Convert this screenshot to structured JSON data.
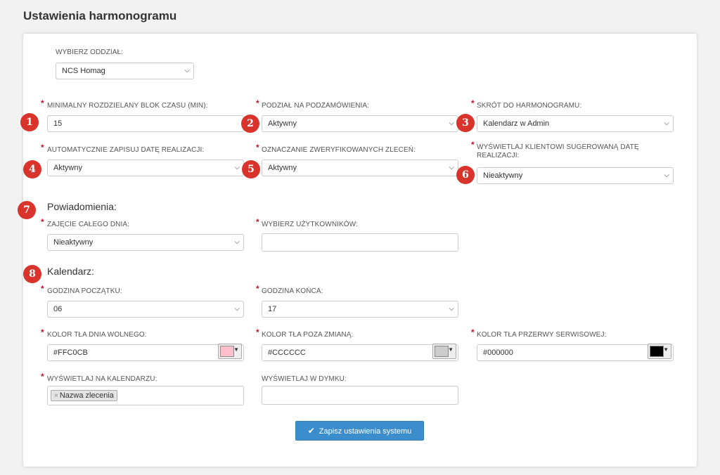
{
  "page": {
    "title": "Ustawienia harmonogramu"
  },
  "branch": {
    "label": "WYBIERZ ODDZIAŁ:",
    "value": "NCS Homag"
  },
  "fields": {
    "min_block": {
      "label": "MINIMALNY ROZDZIELANY BLOK CZASU (MIN):",
      "value": "15"
    },
    "split_orders": {
      "label": "PODZIAŁ NA PODZAMÓWIENIA:",
      "value": "Aktywny"
    },
    "schedule_shortcut": {
      "label": "SKRÓT DO HARMONOGRAMU:",
      "value": "Kalendarz w Admin"
    },
    "auto_save_date": {
      "label": "AUTOMATYCZNIE ZAPISUJ DATĘ REALIZACJI:",
      "value": "Aktywny"
    },
    "mark_verified": {
      "label": "OZNACZANIE ZWERYFIKOWANYCH ZLECEŃ:",
      "value": "Aktywny"
    },
    "show_suggested_date": {
      "label": "WYŚWIETLAJ KLIENTOWI SUGEROWANĄ DATĘ REALIZACJI:",
      "value": "Nieaktywny"
    }
  },
  "notifications": {
    "heading": "Powiadomienia:",
    "full_day": {
      "label": "ZAJĘCIE CAŁEGO DNIA:",
      "value": "Nieaktywny"
    },
    "users": {
      "label": "WYBIERZ UŻYTKOWNIKÓW:",
      "value": ""
    }
  },
  "calendar": {
    "heading": "Kalendarz:",
    "start_hour": {
      "label": "GODZINA POCZĄTKU:",
      "value": "06"
    },
    "end_hour": {
      "label": "GODZINA KOŃCA:",
      "value": "17"
    },
    "day_off_color": {
      "label": "KOLOR TŁA DNIA WOLNEGO:",
      "value": "#FFC0CB",
      "swatch": "#FFC0CB"
    },
    "off_shift_color": {
      "label": "KOLOR TŁA POZA ZMIANĄ:",
      "value": "#CCCCCC",
      "swatch": "#CCCCCC"
    },
    "service_break_color": {
      "label": "KOLOR TŁA PRZERWY SERWISOWEJ:",
      "value": "#000000",
      "swatch": "#000000"
    },
    "show_on_calendar": {
      "label": "WYŚWIETLAJ NA KALENDARZU:",
      "tags": [
        "Nazwa zlecenia"
      ]
    },
    "show_in_tooltip": {
      "label": "WYŚWIETLAJ W DYMKU:",
      "value": ""
    }
  },
  "markers": [
    "1",
    "2",
    "3",
    "4",
    "5",
    "6",
    "7",
    "8"
  ],
  "save_button": {
    "label": "Zapisz ustawienia systemu"
  },
  "colors": {
    "accent": "#3c8dcb",
    "required": "#c8102e",
    "marker": "#d9342b"
  }
}
